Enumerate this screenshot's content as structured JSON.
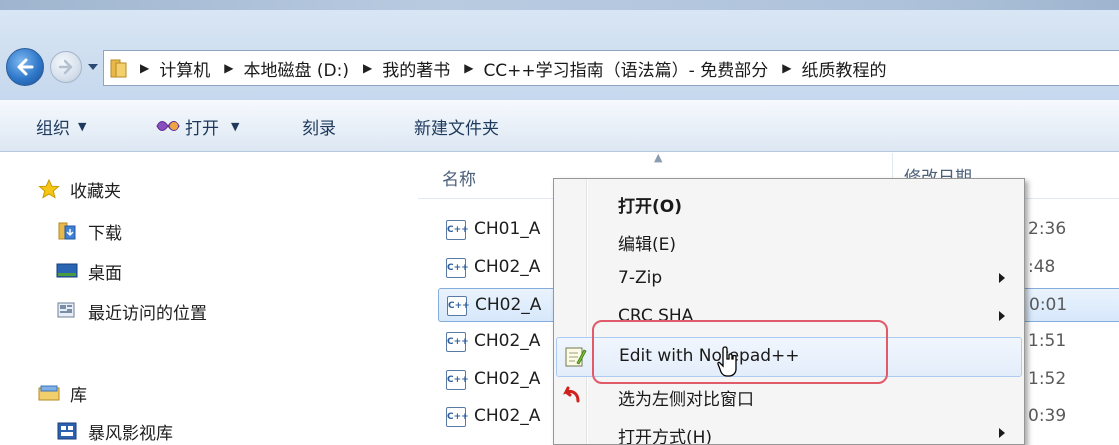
{
  "breadcrumbs": [
    "计算机",
    "本地磁盘 (D:)",
    "我的著书",
    "CC++学习指南（语法篇）- 免费部分",
    "纸质教程的"
  ],
  "toolbar": {
    "organize": "组织",
    "open": "打开",
    "burn": "刻录",
    "new_folder": "新建文件夹"
  },
  "nav": {
    "favorites": "收藏夹",
    "downloads": "下载",
    "desktop": "桌面",
    "recent": "最近访问的位置",
    "libraries": "库",
    "baofeng": "暴风影视库"
  },
  "columns": {
    "name": "名称",
    "date": "修改日期"
  },
  "files": [
    {
      "name": "CH01_A",
      "time": "2:36"
    },
    {
      "name": "CH02_A",
      "time": ":48"
    },
    {
      "name": "CH02_A",
      "time": "0:01"
    },
    {
      "name": "CH02_A",
      "time": "1:51"
    },
    {
      "name": "CH02_A",
      "time": "1:52"
    },
    {
      "name": "CH02_A",
      "time": "0:39"
    }
  ],
  "file_icon_text": "C++",
  "context_menu": {
    "items": [
      {
        "label": "打开(O)"
      },
      {
        "label": "编辑(E)"
      },
      {
        "label": "7-Zip"
      },
      {
        "label": "CRC SHA"
      },
      {
        "label": "Edit with Notepad++"
      },
      {
        "label": "选为左侧对比窗口"
      },
      {
        "label": "打开方式(H)"
      }
    ]
  },
  "colors": {
    "highlight_box": "#e05a6a",
    "selection_border": "#84acdd",
    "toolbar_text": "#1e395b"
  }
}
